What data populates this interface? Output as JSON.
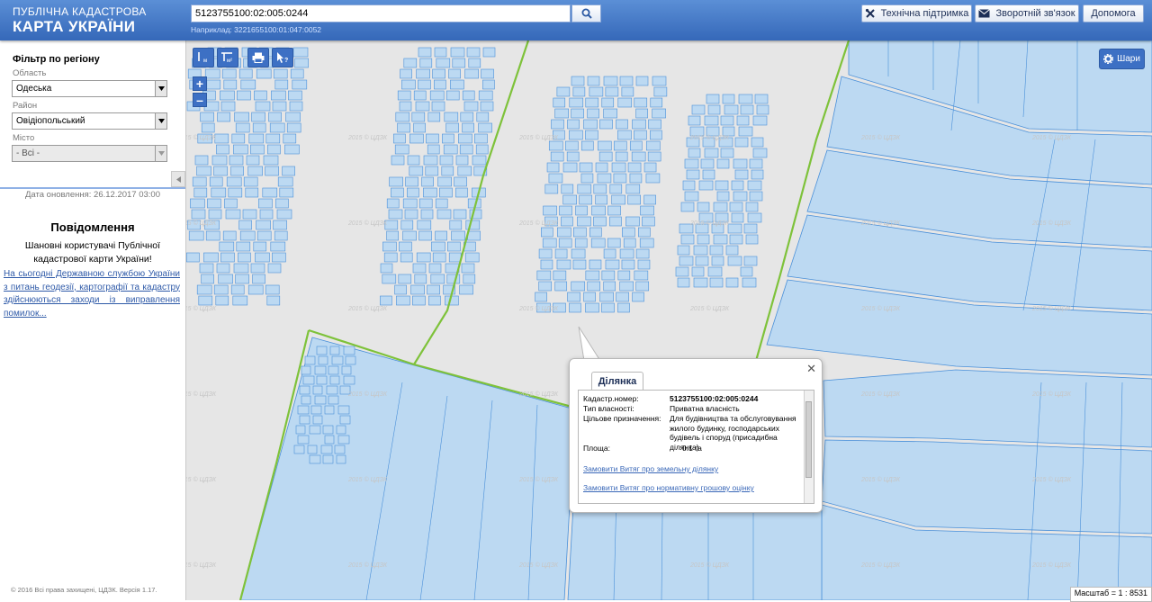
{
  "header": {
    "logo_line1": "ПУБЛІЧНА КАДАСТРОВА",
    "logo_line2": "КАРТА УКРАЇНИ",
    "search_value": "5123755100:02:005:0244",
    "search_hint": "Наприклад: 3221655100:01:047:0052",
    "buttons": {
      "support": "Технічна підтримка",
      "feedback": "Зворотній зв'язок",
      "help": "Допомога"
    }
  },
  "sidebar": {
    "filter_title": "Фільтр по регіону",
    "oblast_label": "Область",
    "oblast_value": "Одеська",
    "raion_label": "Район",
    "raion_value": "Овідіопольський",
    "misto_label": "Місто",
    "misto_value": "- Всі -",
    "updated": "Дата оновлення: 26.12.2017 03:00",
    "news_title": "Повідомлення",
    "news_text": "Шановні користувачі Публічної кадастрової карти України!",
    "news_link": "На сьогодні Державною службою України з питань геодезії, картографії та кадастру здійснюються заходи із виправлення помилок...",
    "copyright": "© 2016 Всі права захищені, ЦДЗК. Версія 1.17."
  },
  "map": {
    "tool_labels": {
      "measure_line": "м",
      "measure_area": "м²"
    },
    "layers_label": "Шари",
    "watermark": "2015 © ЦДЗК",
    "scale": "Масштаб = 1 : 8531",
    "colors": {
      "parcel_fill": "#bcd9f2",
      "parcel_stroke": "#4a90d9",
      "boundary": "#7ec23a",
      "header": "#3d70c4"
    }
  },
  "popup": {
    "tab": "Ділянка",
    "cadastr_label": "Кадастр.номер:",
    "cadastr_value": "5123755100:02:005:0244",
    "owner_label": "Тип власності:",
    "owner_value": "Приватна власність",
    "purpose_label": "Цільове призначення:",
    "purpose_value": "Для будівництва та обслуговування жилого будинку, господарських будівель і споруд (присадибна ділянка)",
    "area_label": "Площа:",
    "area_value": "0.1 га",
    "link1": "Замовити Витяг про земельну ділянку",
    "link2": "Замовити Витяг про нормативну грошову оцінку"
  }
}
